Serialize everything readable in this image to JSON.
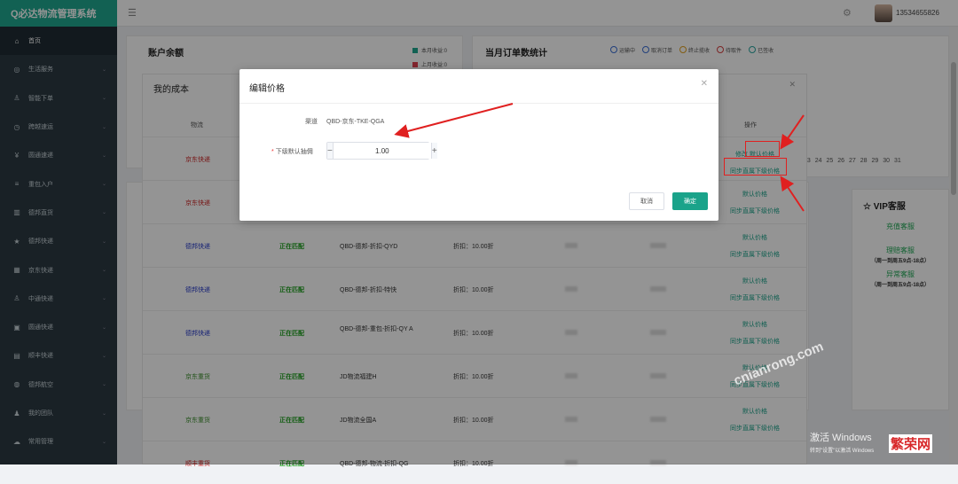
{
  "app": {
    "title": "Q必达物流管理系统"
  },
  "sidebar": {
    "items": [
      {
        "label": "首页",
        "icon": "home-icon",
        "glyph": "⌂"
      },
      {
        "label": "生活服务",
        "icon": "service-icon",
        "glyph": "◎"
      },
      {
        "label": "智能下单",
        "icon": "order-icon",
        "glyph": "♙"
      },
      {
        "label": "跨越速运",
        "icon": "clock-icon",
        "glyph": "◷"
      },
      {
        "label": "圆通速递",
        "icon": "yen-icon",
        "glyph": "¥"
      },
      {
        "label": "重包入户",
        "icon": "list-icon",
        "glyph": "≡"
      },
      {
        "label": "德邦直货",
        "icon": "chart-icon",
        "glyph": "▥"
      },
      {
        "label": "德邦快递",
        "icon": "star-icon",
        "glyph": "★"
      },
      {
        "label": "京东快递",
        "icon": "grid-icon",
        "glyph": "▦"
      },
      {
        "label": "中通快递",
        "icon": "user-icon",
        "glyph": "♙"
      },
      {
        "label": "圆通快递",
        "icon": "box-icon",
        "glyph": "▣"
      },
      {
        "label": "顺丰快递",
        "icon": "money-icon",
        "glyph": "▤"
      },
      {
        "label": "德邦航空",
        "icon": "plane-icon",
        "glyph": "◍"
      },
      {
        "label": "我的团队",
        "icon": "team-icon",
        "glyph": "♟"
      },
      {
        "label": "常用管理",
        "icon": "cloud-icon",
        "glyph": "☁"
      }
    ]
  },
  "topbar": {
    "phone": "13534655826"
  },
  "balance": {
    "title": "账户余额",
    "legend": [
      "本月收益:0",
      "上月收益:0"
    ],
    "colors": [
      "#1fa88f",
      "#e04050"
    ]
  },
  "orders": {
    "title": "当月订单数统计",
    "legend": [
      {
        "label": "运输中",
        "color": "#3b6fd6"
      },
      {
        "label": "取消订单",
        "color": "#3b6fd6"
      },
      {
        "label": "终止揽收",
        "color": "#e0a020"
      },
      {
        "label": "待取件",
        "color": "#d64040"
      },
      {
        "label": "已签收",
        "color": "#2aa5a0"
      }
    ],
    "days": [
      "23",
      "24",
      "25",
      "26",
      "27",
      "28",
      "29",
      "30",
      "31"
    ]
  },
  "cost": {
    "title": "我的成本",
    "headers": {
      "logistics": "物流",
      "ops": "操作"
    },
    "rows": [
      {
        "logistics": "京东快递",
        "status": "",
        "name": "",
        "discount": "",
        "op1": "修改",
        "op2": "默认价格",
        "op3": "同步直属下级价格",
        "type": "jd"
      },
      {
        "logistics": "京东快递",
        "status": "",
        "name": "",
        "discount": "",
        "op1": "",
        "op2": "默认价格",
        "op3": "同步直属下级价格",
        "type": "jd"
      },
      {
        "logistics": "德邦快递",
        "status": "正在匹配",
        "name": "QBD-德邦-折扣-QYD",
        "discount": "折扣：10.00折",
        "op1": "",
        "op2": "默认价格",
        "op3": "同步直属下级价格",
        "type": "db"
      },
      {
        "logistics": "德邦快递",
        "status": "正在匹配",
        "name": "QBD-德邦-折扣-特快",
        "discount": "折扣：10.00折",
        "op1": "",
        "op2": "默认价格",
        "op3": "同步直属下级价格",
        "type": "db"
      },
      {
        "logistics": "德邦快递",
        "status": "正在匹配",
        "name": "QBD-德邦-重包-折扣-QY A",
        "discount": "折扣：10.00折",
        "op1": "",
        "op2": "默认价格",
        "op3": "同步直属下级价格",
        "type": "db"
      },
      {
        "logistics": "京东重货",
        "status": "正在匹配",
        "name": "JD物流福建H",
        "discount": "折扣：10.00折",
        "op1": "",
        "op2": "默认价格",
        "op3": "同步直属下级价格",
        "type": "jx"
      },
      {
        "logistics": "京东重货",
        "status": "正在匹配",
        "name": "JD物流全国A",
        "discount": "折扣：10.00折",
        "op1": "",
        "op2": "默认价格",
        "op3": "同步直属下级价格",
        "type": "jx"
      },
      {
        "logistics": "顺丰重货",
        "status": "正在匹配",
        "name": "QBD-德邦-物流-折扣-QG",
        "discount": "折扣：10.00折",
        "op1": "",
        "op2": "",
        "op3": "",
        "type": "sf"
      }
    ]
  },
  "vip": {
    "title": "VIP客服",
    "links": [
      {
        "label": "充值客服",
        "hours": ""
      },
      {
        "label": "理赔客服",
        "hours": "（周一到周五9点-18点）"
      },
      {
        "label": "异常客服",
        "hours": "（周一到周五9点-18点）"
      }
    ]
  },
  "modal": {
    "title": "编辑价格",
    "channel_label": "渠道",
    "channel_value": "QBD-京东-TKE-QGA",
    "commission_label": "下级默认抽佣",
    "commission_value": "1.00",
    "cancel_label": "取消",
    "ok_label": "确定"
  },
  "overlay": {
    "watermark": "cnianrong.com",
    "windows_line1": "激活 Windows",
    "windows_line2": "转到\"设置\"以激活 Windows",
    "brand": "繁荣网"
  }
}
